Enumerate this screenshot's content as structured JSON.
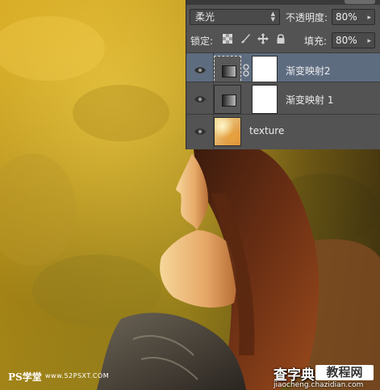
{
  "layers_panel": {
    "blend_mode": "柔光",
    "opacity_label": "不透明度:",
    "opacity_value": "80%",
    "lock_label": "锁定:",
    "fill_label": "填充:",
    "fill_value": "80%",
    "layers": [
      {
        "name": "渐变映射2",
        "type": "gradient-map",
        "selected": true,
        "visible": true
      },
      {
        "name": "渐变映射 1",
        "type": "gradient-map",
        "selected": false,
        "visible": true
      },
      {
        "name": "texture",
        "type": "image",
        "selected": false,
        "visible": true
      }
    ]
  },
  "watermarks": {
    "left_logo": "PS学堂",
    "left_url": "www.52PSXT.COM",
    "right_logo": "查字典",
    "right_box": "教程网",
    "right_domain": "jiaocheng.chazidian.com"
  },
  "colors": {
    "panel_bg": "#535353",
    "selected_row": "#5e6c80",
    "artwork_gold": "#c9a01c"
  }
}
